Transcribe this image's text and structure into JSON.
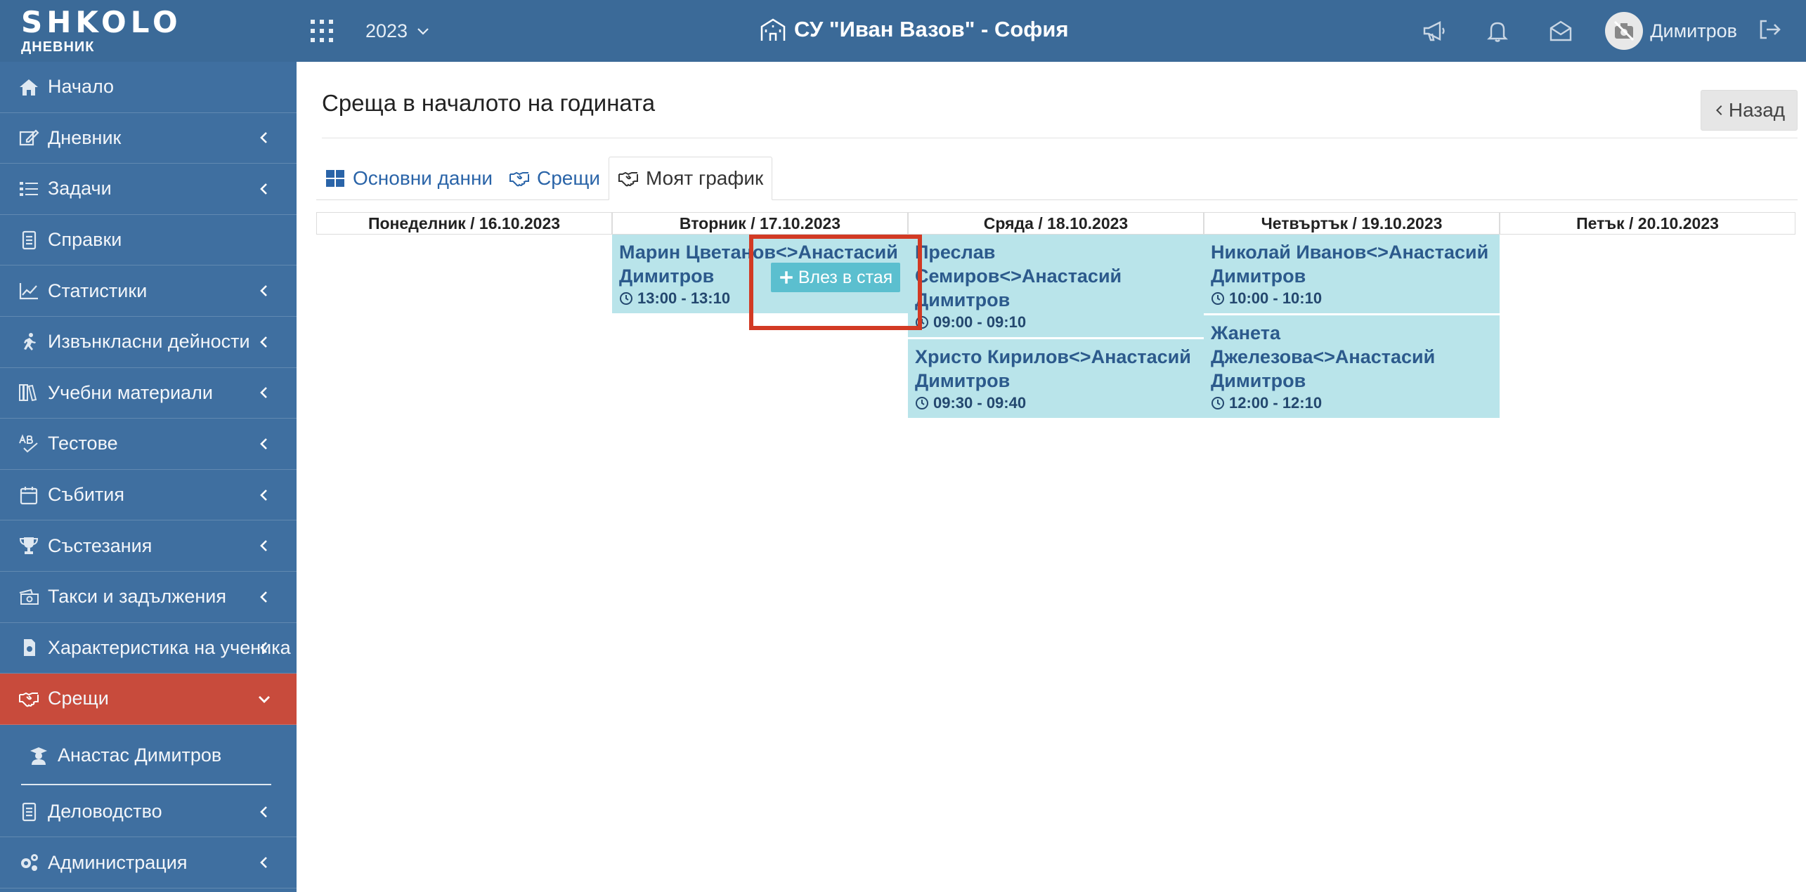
{
  "header": {
    "logo_main": "SHKOLO",
    "logo_sub": "ДНЕВНИК",
    "year": "2023",
    "school": "СУ \"Иван Вазов\" - София",
    "user_name": "Димитров"
  },
  "sidebar": {
    "items": [
      {
        "label": "Начало",
        "icon": "home-icon"
      },
      {
        "label": "Дневник",
        "icon": "edit-icon"
      },
      {
        "label": "Задачи",
        "icon": "tasks-icon"
      },
      {
        "label": "Справки",
        "icon": "document-icon"
      },
      {
        "label": "Статистики",
        "icon": "chart-icon"
      },
      {
        "label": "Извънкласни дейности",
        "icon": "runner-icon"
      },
      {
        "label": "Учебни материали",
        "icon": "books-icon"
      },
      {
        "label": "Тестове",
        "icon": "spellcheck-icon"
      },
      {
        "label": "Събития",
        "icon": "calendar-icon"
      },
      {
        "label": "Състезания",
        "icon": "trophy-icon"
      },
      {
        "label": "Такси и задължения",
        "icon": "money-icon"
      },
      {
        "label": "Характеристика на ученика",
        "icon": "file-icon"
      },
      {
        "label": "Срещи",
        "icon": "handshake-icon"
      }
    ],
    "sub_item": "Анастас Димитров",
    "bottom_items": [
      {
        "label": "Деловодство",
        "icon": "document-icon"
      },
      {
        "label": "Администрация",
        "icon": "gears-icon"
      }
    ]
  },
  "page": {
    "title": "Среща в началото на годината",
    "back_label": "Назад",
    "tabs": [
      "Основни данни",
      "Срещи",
      "Моят график"
    ]
  },
  "schedule": {
    "days": [
      {
        "label": "Понеделник / 16.10.2023",
        "meetings": []
      },
      {
        "label": "Вторник / 17.10.2023",
        "meetings": [
          {
            "title": "Марин Цветанов<>Анастасий Димитров",
            "time": "13:00 - 13:10"
          }
        ]
      },
      {
        "label": "Сряда / 18.10.2023",
        "meetings": [
          {
            "title": "Преслав Семиров<>Анастасий Димитров",
            "time": "09:00 - 09:10"
          },
          {
            "title": "Христо Кирилов<>Анастасий Димитров",
            "time": "09:30 - 09:40"
          }
        ]
      },
      {
        "label": "Четвъртък / 19.10.2023",
        "meetings": [
          {
            "title": "Николай Иванов<>Анастасий Димитров",
            "time": "10:00 - 10:10"
          },
          {
            "title": "Жанета Джелезова<>Анастасий Димитров",
            "time": "12:00 - 12:10"
          }
        ]
      },
      {
        "label": "Петък / 20.10.2023",
        "meetings": []
      }
    ],
    "join_label": "Влез в стая"
  },
  "colors": {
    "topbar": "#3b6a98",
    "sidebar": "#3f6fa0",
    "active_item": "#c84b3c",
    "meeting_bg": "#b9e4ea",
    "join_button": "#5bbfcf",
    "highlight": "#d23a24"
  }
}
